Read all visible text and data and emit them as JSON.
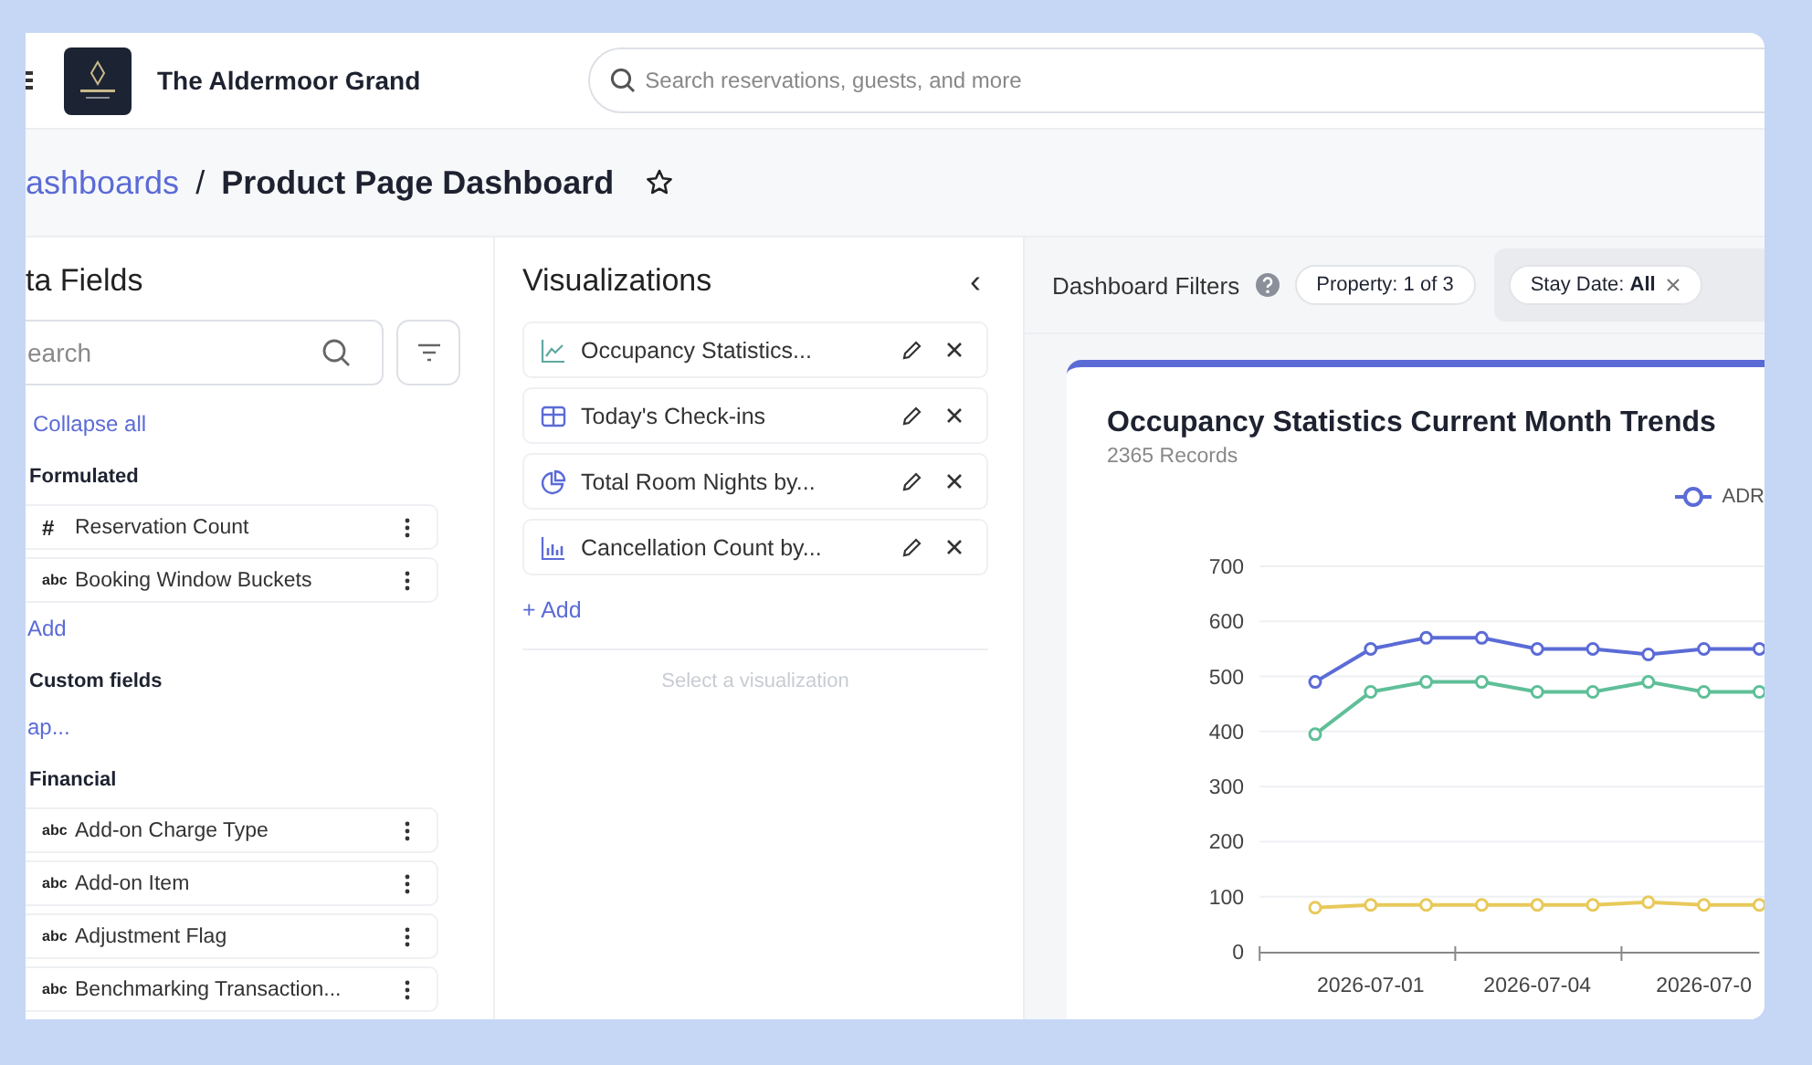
{
  "header": {
    "hotel_name": "The Aldermoor Grand",
    "search": {
      "placeholder": "Search reservations, guests, and more"
    }
  },
  "breadcrumb": {
    "parent": "ashboards",
    "separator": "/",
    "current": "Product Page Dashboard"
  },
  "data_fields": {
    "title": "ta Fields",
    "search": {
      "placeholder": "earch"
    },
    "collapse_link": "Collapse all",
    "groups": [
      {
        "title": "Formulated",
        "items": [
          {
            "type_label": "#",
            "label": "Reservation Count"
          },
          {
            "type_label": "abc",
            "label": "Booking Window Buckets"
          }
        ],
        "link": "Add"
      },
      {
        "title": "Custom fields",
        "link": "ap..."
      },
      {
        "title": "Financial",
        "items": [
          {
            "type_label": "abc",
            "label": "Add-on Charge Type"
          },
          {
            "type_label": "abc",
            "label": "Add-on Item"
          },
          {
            "type_label": "abc",
            "label": "Adjustment Flag"
          },
          {
            "type_label": "abc",
            "label": "Benchmarking Transaction..."
          }
        ]
      }
    ]
  },
  "visualizations": {
    "title": "Visualizations",
    "collapse": "‹",
    "items": [
      {
        "kind": "line",
        "label": "Occupancy Statistics..."
      },
      {
        "kind": "table",
        "label": "Today's Check-ins"
      },
      {
        "kind": "pie",
        "label": "Total Room Nights by..."
      },
      {
        "kind": "bar",
        "label": "Cancellation Count by..."
      }
    ],
    "add_link": "+ Add",
    "empty_hint": "Select a visualization"
  },
  "filters": {
    "title": "Dashboard Filters",
    "chips": [
      {
        "label": "Property: 1 of 3",
        "removable": false
      },
      {
        "label": "Stay Date: **All**",
        "removable": true
      }
    ]
  },
  "chart_card": {
    "title": "Occupancy Statistics Current Month Trends",
    "subtitle": "2365 Records",
    "chart_data": {
      "type": "line",
      "x": [
        "2026-06-30",
        "2026-07-01",
        "2026-07-02",
        "2026-07-03",
        "2026-07-04",
        "2026-07-05",
        "2026-07-06",
        "2026-07-07",
        "2026-07-08"
      ],
      "series": [
        {
          "name": "ADR",
          "color": "#5b6bd6",
          "marker": "circle",
          "values": [
            490,
            550,
            570,
            570,
            550,
            550,
            540,
            550,
            550
          ]
        },
        {
          "color": "#5fbf98",
          "marker": "circle",
          "values": [
            395,
            472,
            490,
            490,
            472,
            472,
            490,
            472,
            472
          ]
        },
        {
          "color": "#e8c95a",
          "marker": "circle",
          "values": [
            80,
            85,
            85,
            85,
            85,
            85,
            90,
            85,
            85
          ]
        }
      ],
      "xlim": [
        "2026-06-29",
        "2026-07-08"
      ],
      "grid": true,
      "ylim": [
        0,
        700
      ],
      "yticks": [
        0,
        100,
        200,
        300,
        400,
        500,
        600,
        700
      ],
      "xticks": [
        {
          "value": "2026-07-01",
          "label": "2026-07-01"
        },
        {
          "value": "2026-07-04",
          "label": "2026-07-04"
        },
        {
          "value": "2026-07-07",
          "label": "2026-07-0"
        }
      ]
    }
  }
}
